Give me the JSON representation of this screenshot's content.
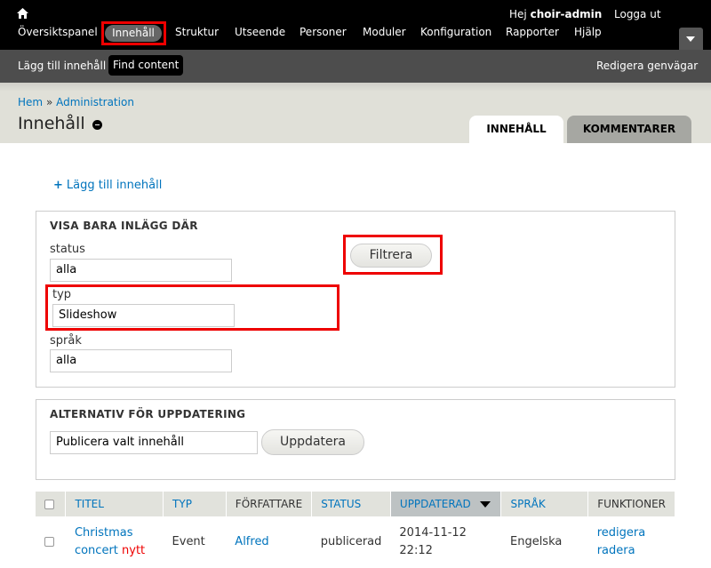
{
  "toolbar": {
    "greeting": "Hej",
    "username": "choir-admin",
    "logout": "Logga ut",
    "menu": [
      "Översiktspanel",
      "Innehåll",
      "Struktur",
      "Utseende",
      "Personer",
      "Moduler",
      "Konfiguration",
      "Rapporter",
      "Hjälp"
    ]
  },
  "shortcuts": {
    "add_content": "Lägg till innehåll",
    "find_content": "Find content",
    "edit_shortcuts": "Redigera genvägar"
  },
  "breadcrumb": {
    "home": "Hem",
    "separator": "»",
    "admin": "Administration"
  },
  "page_title": "Innehåll",
  "tabs": [
    "INNEHÅLL",
    "KOMMENTARER"
  ],
  "add_link": {
    "icon": "+",
    "label": "Lägg till innehåll"
  },
  "filter": {
    "legend": "VISA BARA INLÄGG DÄR",
    "status_label": "status",
    "status_value": "alla",
    "type_label": "typ",
    "type_value": "Slideshow",
    "lang_label": "språk",
    "lang_value": "alla",
    "button": "Filtrera"
  },
  "update": {
    "legend": "ALTERNATIV FÖR UPPDATERING",
    "select_value": "Publicera valt innehåll",
    "button": "Uppdatera"
  },
  "table": {
    "headers": [
      "TITEL",
      "TYP",
      "FÖRFATTARE",
      "STATUS",
      "UPPDATERAD",
      "SPRÅK",
      "FUNKTIONER"
    ],
    "rows": [
      {
        "title": "Christmas concert",
        "new": "nytt",
        "type": "Event",
        "author": "Alfred",
        "status": "publicerad",
        "updated_date": "2014-11-12",
        "updated_time": "22:12",
        "language": "Engelska",
        "edit": "redigera",
        "delete": "radera"
      }
    ]
  },
  "colors": {
    "toolbar": "#000000",
    "shortcuts": "#4d4d4d",
    "link": "#0074bd",
    "highlight": "#ee0000",
    "header": "#e0e0d8"
  }
}
